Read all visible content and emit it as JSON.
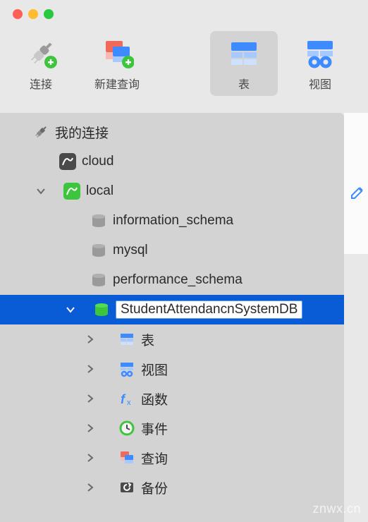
{
  "toolbar": {
    "connect": "连接",
    "newQuery": "新建查询",
    "table": "表",
    "view": "视图"
  },
  "tree": {
    "root": "我的连接",
    "conn1": "cloud",
    "conn2": "local",
    "db1": "information_schema",
    "db2": "mysql",
    "db3": "performance_schema",
    "db4": "StudentAttendancnSystemDB",
    "sub": {
      "tables": "表",
      "views": "视图",
      "functions": "函数",
      "events": "事件",
      "queries": "查询",
      "backups": "备份"
    }
  },
  "watermark": "znwx.cn"
}
